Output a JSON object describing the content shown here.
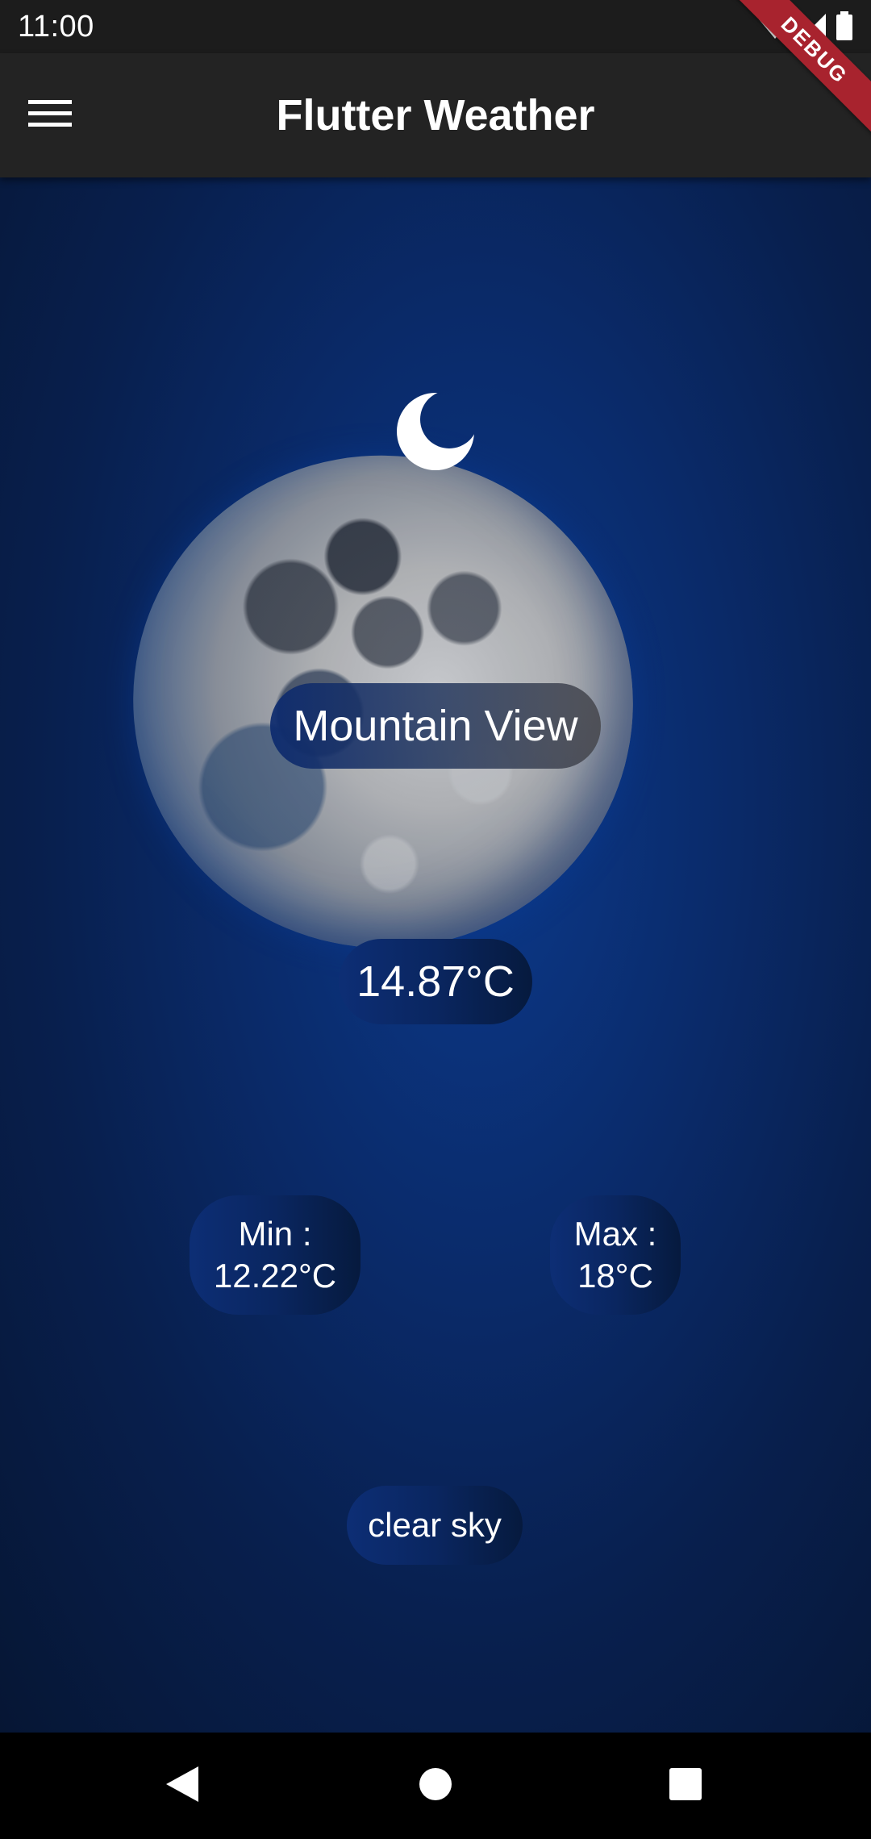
{
  "status_bar": {
    "time": "11:00",
    "icons": [
      "wifi-icon",
      "cell-signal-icon",
      "battery-icon"
    ]
  },
  "debug_banner": {
    "label": "DEBUG",
    "color": "#a8232e"
  },
  "app_bar": {
    "title": "Flutter Weather",
    "menu_icon": "menu-icon"
  },
  "weather": {
    "icon": "crescent-moon-icon",
    "city": "Mountain View",
    "temperature": "14.87°C",
    "min_label": "Min :",
    "min_value": "12.22°C",
    "max_label": "Max :",
    "max_value": "18°C",
    "description": "clear sky"
  },
  "nav_bar": {
    "buttons": [
      "back-icon",
      "home-icon",
      "recents-icon"
    ]
  },
  "colors": {
    "background": "#0a2b6b",
    "app_bar": "#232323",
    "text": "#ffffff"
  }
}
